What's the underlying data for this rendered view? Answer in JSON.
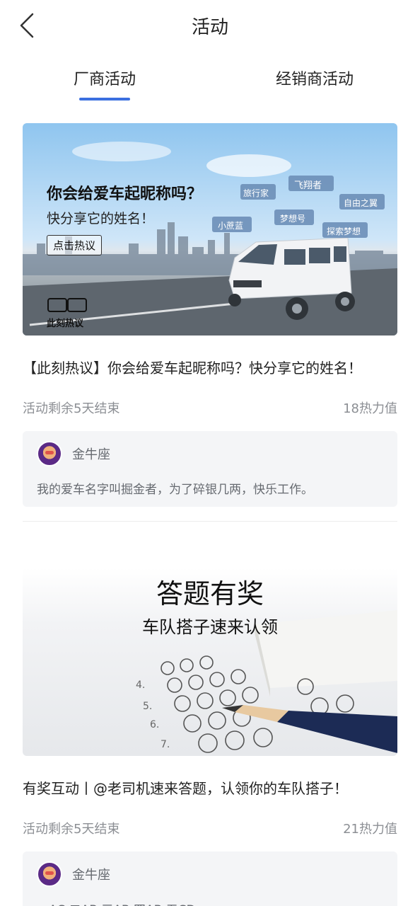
{
  "header": {
    "title": "活动"
  },
  "tabs": [
    {
      "label": "厂商活动",
      "active": true
    },
    {
      "label": "经销商活动",
      "active": false
    }
  ],
  "accent_color": "#3b6fe0",
  "activities": [
    {
      "banner": {
        "headline": "你会给爱车起昵称吗？",
        "subhead": "快分享它的姓名！",
        "cta": "点击热议",
        "logo_label": "此刻热议",
        "bubbles": [
          "飞翔者",
          "旅行家",
          "自由之翼",
          "梦想号",
          "小蔗蓝",
          "探索梦想"
        ]
      },
      "title": "【此刻热议】你会给爱车起昵称吗？快分享它的姓名！",
      "remaining": "活动剩余5天结束",
      "heat": "18热力值",
      "comment": {
        "user": "金牛座",
        "text": "我的爱车名字叫掘金者，为了碎银几两，快乐工作。"
      }
    },
    {
      "banner": {
        "headline": "答题有奖",
        "subhead": "车队搭子速来认领"
      },
      "title": "有奖互动丨@老司机速来答题，认领你的车队搭子！",
      "remaining": "活动剩余5天结束",
      "heat": "21热力值",
      "comment": {
        "user": "金牛座",
        "text": "一AC 二AB 三AB 四AB 五CD"
      }
    }
  ]
}
